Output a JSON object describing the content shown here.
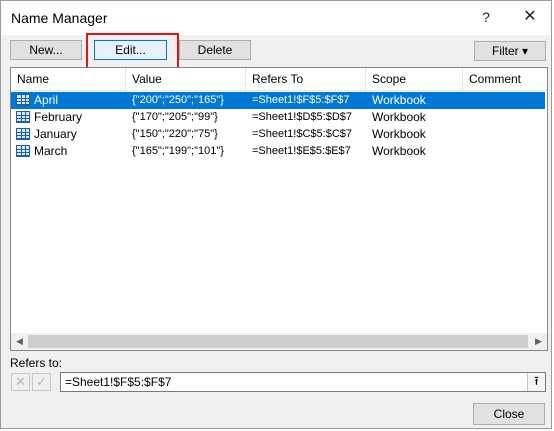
{
  "window": {
    "title": "Name Manager",
    "help_label": "?",
    "close_glyph": "✕"
  },
  "toolbar": {
    "new_label": "New...",
    "edit_label": "Edit...",
    "delete_label": "Delete",
    "filter_label": "Filter ▾"
  },
  "table": {
    "columns": [
      "Name",
      "Value",
      "Refers To",
      "Scope",
      "Comment"
    ],
    "rows": [
      {
        "name": "April",
        "value": "{\"200\";\"250\";\"165\"}",
        "refers_to": "=Sheet1!$F$5:$F$7",
        "scope": "Workbook",
        "comment": "",
        "selected": true
      },
      {
        "name": "February",
        "value": "{\"170\";\"205\";\"99\"}",
        "refers_to": "=Sheet1!$D$5:$D$7",
        "scope": "Workbook",
        "comment": "",
        "selected": false
      },
      {
        "name": "January",
        "value": "{\"150\";\"220\";\"75\"}",
        "refers_to": "=Sheet1!$C$5:$C$7",
        "scope": "Workbook",
        "comment": "",
        "selected": false
      },
      {
        "name": "March",
        "value": "{\"165\";\"199\";\"101\"}",
        "refers_to": "=Sheet1!$E$5:$E$7",
        "scope": "Workbook",
        "comment": "",
        "selected": false
      }
    ]
  },
  "scrollbar": {
    "left_arrow": "◀",
    "right_arrow": "▶"
  },
  "refers_to": {
    "label": "Refers to:",
    "value": "=Sheet1!$F$5:$F$7",
    "cancel_glyph": "✕",
    "ok_glyph": "✓",
    "collapse_glyph": "⭱"
  },
  "footer": {
    "close_label": "Close"
  },
  "colors": {
    "selection": "#0078d7",
    "highlight_box": "#e0151b"
  }
}
